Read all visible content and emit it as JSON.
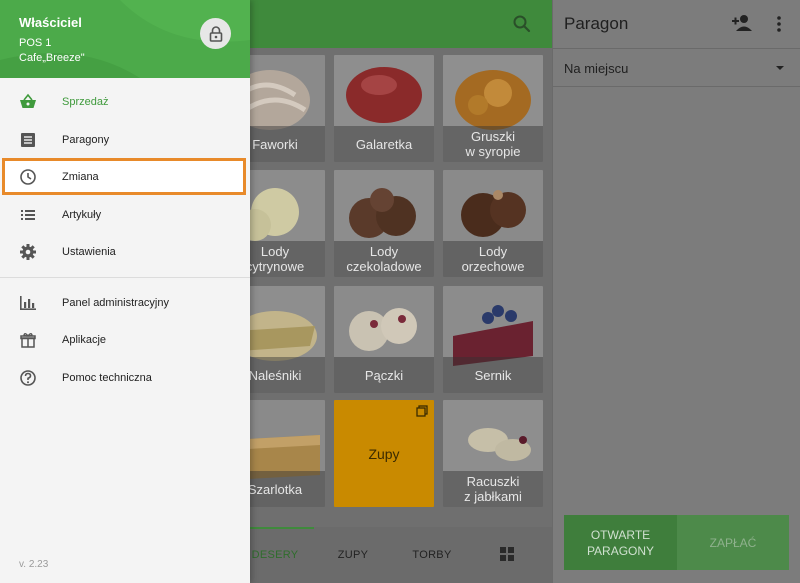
{
  "drawer": {
    "owner": "Właściciel",
    "pos": "POS 1",
    "cafe": "Cafe„Breeze\"",
    "version": "v. 2.23",
    "nav": [
      {
        "label": "Sprzedaż",
        "icon": "basket-icon"
      },
      {
        "label": "Paragony",
        "icon": "receipt-icon"
      },
      {
        "label": "Zmiana",
        "icon": "clock-icon"
      },
      {
        "label": "Artykuły",
        "icon": "list-icon"
      },
      {
        "label": "Ustawienia",
        "icon": "gear-icon"
      },
      {
        "label": "Panel administracyjny",
        "icon": "bar-chart-icon"
      },
      {
        "label": "Aplikacje",
        "icon": "apps-icon"
      },
      {
        "label": "Pomoc techniczna",
        "icon": "help-icon"
      }
    ]
  },
  "tiles": [
    {
      "label": "Faworki"
    },
    {
      "label": "Galaretka"
    },
    {
      "label": "Gruszki\nw syropie"
    },
    {
      "label": "Lody\ncytrynowe"
    },
    {
      "label": "Lody\nczekoladowe"
    },
    {
      "label": "Lody\norzechowe"
    },
    {
      "label": "Naleśniki"
    },
    {
      "label": "Pączki"
    },
    {
      "label": "Sernik"
    },
    {
      "label": "Szarlotka"
    },
    {
      "label": "Zupy"
    },
    {
      "label": "Racuszki\nz jabłkami"
    }
  ],
  "bottom_tabs": {
    "desery": "DESERY",
    "zupy": "ZUPY",
    "torby": "TORBY"
  },
  "receipt": {
    "title": "Paragon",
    "order_type": "Na miejscu",
    "open_receipts": "OTWARTE\nPARAGONY",
    "pay": "ZAPŁAĆ"
  },
  "colors": {
    "brand_green": "#4caa4a",
    "highlight_orange": "#e88a2a",
    "folder_orange": "#f0a500"
  }
}
